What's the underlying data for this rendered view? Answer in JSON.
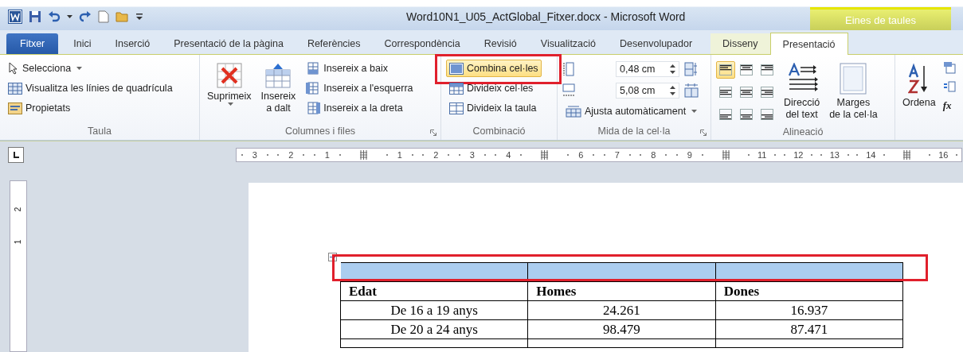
{
  "window": {
    "title": "Word10N1_U05_ActGlobal_Fitxer.docx - Microsoft Word"
  },
  "contextual_header": "Eines de taules",
  "tabs": [
    {
      "label": "Fitxer",
      "selected": false,
      "kind": "file"
    },
    {
      "label": "Inici",
      "selected": false,
      "kind": "normal"
    },
    {
      "label": "Inserció",
      "selected": false,
      "kind": "normal"
    },
    {
      "label": "Presentació de la pàgina",
      "selected": false,
      "kind": "normal"
    },
    {
      "label": "Referències",
      "selected": false,
      "kind": "normal"
    },
    {
      "label": "Correspondència",
      "selected": false,
      "kind": "normal"
    },
    {
      "label": "Revisió",
      "selected": false,
      "kind": "normal"
    },
    {
      "label": "Visualització",
      "selected": false,
      "kind": "normal"
    },
    {
      "label": "Desenvolupador",
      "selected": false,
      "kind": "normal"
    },
    {
      "label": "Disseny",
      "selected": false,
      "kind": "contextual"
    },
    {
      "label": "Presentació",
      "selected": true,
      "kind": "contextual"
    }
  ],
  "taula": {
    "label": "Taula",
    "items": [
      {
        "label": "Selecciona",
        "dropdown": true
      },
      {
        "label": "Visualitza les línies de quadrícula",
        "dropdown": false
      },
      {
        "label": "Propietats",
        "dropdown": false
      }
    ]
  },
  "columnes": {
    "label": "Columnes i files",
    "delete": "Suprimeix",
    "above": [
      "Insereix",
      "a dalt"
    ],
    "items": [
      "Insereix a baix",
      "Insereix a l'esquerra",
      "Insereix a la dreta"
    ]
  },
  "combinacio": {
    "label": "Combinació",
    "items": [
      {
        "label": "Combina cel·les",
        "selected": true,
        "highlighted": true
      },
      {
        "label": "Divideix cel·les",
        "selected": false,
        "highlighted": false
      },
      {
        "label": "Divideix la taula",
        "selected": false,
        "highlighted": false
      }
    ]
  },
  "mida": {
    "label": "Mida de la cel·la",
    "height": "0,48 cm",
    "width": "5,08 cm",
    "autofit": "Ajusta automàticament"
  },
  "alineacio": {
    "label": "Alineació",
    "cells": [
      {
        "selected": true
      },
      {
        "selected": false
      },
      {
        "selected": false
      },
      {
        "selected": false
      },
      {
        "selected": false
      },
      {
        "selected": false
      },
      {
        "selected": false
      },
      {
        "selected": false
      },
      {
        "selected": false
      }
    ],
    "direction": [
      "Direcció",
      "del text"
    ],
    "margins": [
      "Marges",
      "de la cel·la"
    ]
  },
  "ordena": {
    "label": "Ordena",
    "fx": "fx"
  },
  "ruler": [
    {
      "kind": "number",
      "text": "3"
    },
    {
      "kind": "number",
      "text": "2"
    },
    {
      "kind": "number",
      "text": "1"
    },
    {
      "kind": "marker"
    },
    {
      "kind": "number",
      "text": "1"
    },
    {
      "kind": "number",
      "text": "2"
    },
    {
      "kind": "number",
      "text": "3"
    },
    {
      "kind": "number",
      "text": "4"
    },
    {
      "kind": "marker"
    },
    {
      "kind": "number",
      "text": "6"
    },
    {
      "kind": "number",
      "text": "7"
    },
    {
      "kind": "number",
      "text": "8"
    },
    {
      "kind": "number",
      "text": "9"
    },
    {
      "kind": "marker"
    },
    {
      "kind": "number",
      "text": "11"
    },
    {
      "kind": "number",
      "text": "12"
    },
    {
      "kind": "number",
      "text": "13"
    },
    {
      "kind": "number",
      "text": "14"
    },
    {
      "kind": "marker"
    },
    {
      "kind": "number",
      "text": "16"
    }
  ],
  "vertical_ruler": [
    "2",
    "1"
  ],
  "table": {
    "blank_row": {
      "selected": true,
      "highlighted": true
    },
    "header": [
      "Edat",
      "Homes",
      "Dones"
    ],
    "rows": [
      {
        "cells": [
          "De 16 a 19 anys",
          "24.261",
          "16.937"
        ]
      },
      {
        "cells": [
          "De 20 a 24 anys",
          "98.479",
          "87.471"
        ]
      }
    ]
  }
}
